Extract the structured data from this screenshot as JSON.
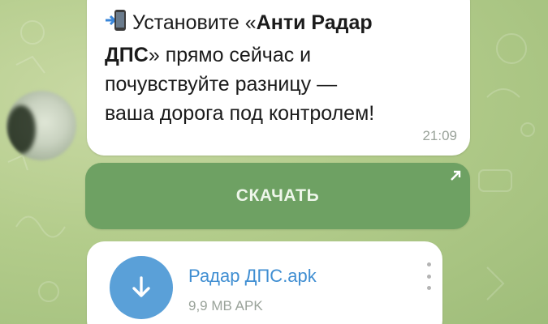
{
  "message": {
    "prefix": "Установите «",
    "app_name": "Анти Радар",
    "line2_bold": "ДПС",
    "line2_rest": "» прямо сейчас и",
    "line3": "почувствуйте разницу —",
    "line4": "ваша дорога под контролем!",
    "time": "21:09",
    "icon": "phone-arrow-icon"
  },
  "download_button": {
    "label": "СКАЧАТЬ",
    "icon": "external-arrow-icon",
    "color": "#6ea163"
  },
  "file": {
    "name": "Радар ДПС.apk",
    "meta": "9,9 MB APK",
    "icon": "download-arrow-icon",
    "accent": "#5aa0d8"
  }
}
